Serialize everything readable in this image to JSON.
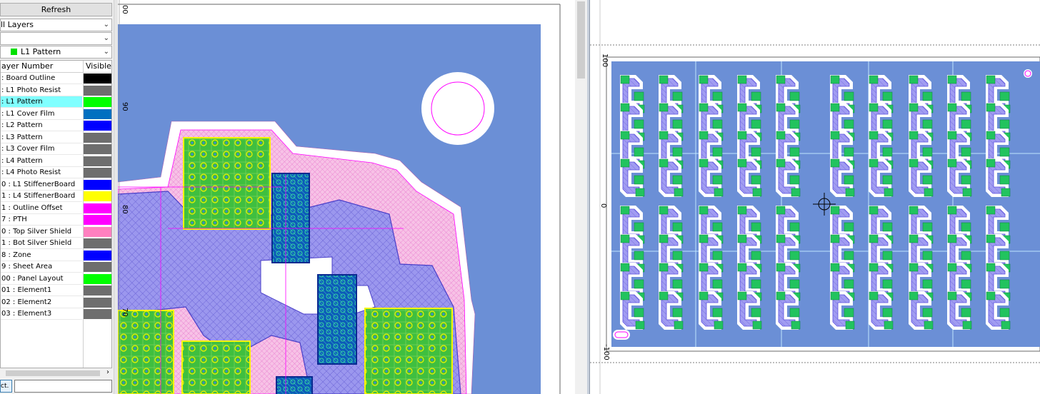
{
  "layer_panel": {
    "refresh_label": "Refresh",
    "combo1_value": "ll Layers",
    "combo2_value": "",
    "combo3_value": "L1 Pattern",
    "header_name": "ayer Number",
    "header_visible": "Visible",
    "layers": [
      {
        "label": ": Board Outline",
        "color": "#000000"
      },
      {
        "label": ": L1 Photo Resist",
        "color": "#6e6e6e"
      },
      {
        "label": ": L1 Pattern",
        "color": "#00ff00",
        "selected": true
      },
      {
        "label": ": L1 Cover Film",
        "color": "#0070c0"
      },
      {
        "label": ": L2 Pattern",
        "color": "#0000ff"
      },
      {
        "label": ": L3 Pattern",
        "color": "#6e6e6e"
      },
      {
        "label": ": L3 Cover Film",
        "color": "#6e6e6e"
      },
      {
        "label": ": L4 Pattern",
        "color": "#6e6e6e"
      },
      {
        "label": ": L4 Photo Resist",
        "color": "#6e6e6e"
      },
      {
        "label": "0 : L1 StiffenerBoard",
        "color": "#0000ff"
      },
      {
        "label": "1 : L4 StiffenerBoard",
        "color": "#ffff00"
      },
      {
        "label": "1 : Outline Offset",
        "color": "#ff00ff"
      },
      {
        "label": "7 : PTH",
        "color": "#ff00ff"
      },
      {
        "label": "0 : Top Silver Shield",
        "color": "#ff80c0"
      },
      {
        "label": "1 : Bot Silver Shield",
        "color": "#6e6e6e"
      },
      {
        "label": "8 : Zone",
        "color": "#0000ff"
      },
      {
        "label": "9 : Sheet Area",
        "color": "#6e6e6e"
      },
      {
        "label": "00 : Panel Layout",
        "color": "#00ff00"
      },
      {
        "label": "01 : Element1",
        "color": "#6e6e6e"
      },
      {
        "label": "02 : Element2",
        "color": "#6e6e6e"
      },
      {
        "label": "03 : Element3",
        "color": "#6e6e6e"
      }
    ],
    "act_button_label": "ct."
  },
  "mid_view": {
    "ruler_labels": [
      "90",
      "80",
      "70",
      "00"
    ]
  },
  "right_view": {
    "ruler_labels": [
      "100",
      "0",
      "-100"
    ]
  },
  "colors": {
    "board_blue": "#6b8fd6",
    "pad_green": "#22c35e",
    "trace_purple": "#8f8ef0",
    "outline_magenta": "#ff00ff",
    "shield_pink": "#f0a8d8",
    "stiffener_yellow": "#f5f500"
  }
}
